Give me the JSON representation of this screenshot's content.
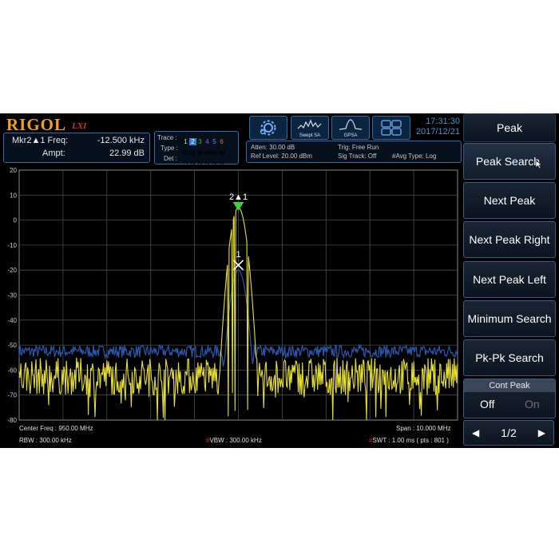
{
  "brand": {
    "logo": "RIGOL",
    "sub": "LXI"
  },
  "marker": {
    "freq_label": "Mkr2▲1 Freq:",
    "freq_value": "-12.500 kHz",
    "ampt_label": "Ampt:",
    "ampt_value": "22.99 dB"
  },
  "trace": {
    "label": "Trace :",
    "type_label": "Type :",
    "det_label": "Det :",
    "numbers": [
      "1",
      "2",
      "3",
      "4",
      "5",
      "6"
    ],
    "number_colors": [
      "#e8e070",
      "#ffffff",
      "#30c030",
      "#d040d0",
      "#40a0f0",
      "#f07030"
    ],
    "types": [
      "W",
      "M",
      "W",
      "W",
      "W",
      "W"
    ],
    "dets": [
      "S",
      "N",
      "N",
      "N",
      "N",
      "N"
    ]
  },
  "settings": {
    "atten": "Atten: 30.00 dB",
    "ref_level": "Ref Level: 20.00 dBm",
    "trig": "Trig: Free Run",
    "sig_track": "Sig Track: Off",
    "avg_type": "#Avg Type: Log"
  },
  "mode_icons": [
    {
      "name": "setup-icon",
      "label": ""
    },
    {
      "name": "swept-sa-icon",
      "label": "Swept SA"
    },
    {
      "name": "gpsa-icon",
      "label": "GPSA"
    },
    {
      "name": "layout-grid-icon",
      "label": ""
    }
  ],
  "clock": {
    "time": "17:31:30",
    "date": "2017/12/21"
  },
  "softkeys": {
    "title": "Peak",
    "items": [
      "Peak Search",
      "Next Peak",
      "Next Peak Right",
      "Next Peak Left",
      "Minimum Search",
      "Pk-Pk Search"
    ],
    "cont_peak": {
      "label": "Cont Peak",
      "off": "Off",
      "on": "On"
    },
    "page": "1/2"
  },
  "chart_data": {
    "type": "line",
    "y_ticks": [
      "20",
      "10",
      "0",
      "-10",
      "-20",
      "-30",
      "-40",
      "-50",
      "-60",
      "-70",
      "-80"
    ],
    "ylim": [
      -80,
      20
    ],
    "grid": true,
    "series": [
      {
        "color": "#e8e030",
        "peak_db": 5,
        "noise_floor_db": [
          -70,
          -55
        ]
      },
      {
        "color": "#2858b0",
        "peak_db": -20,
        "noise_floor_db": [
          -55,
          -50
        ]
      }
    ],
    "markers": [
      {
        "label": "2▲1",
        "value_db": 5
      },
      {
        "label": "1",
        "value_db": -18
      }
    ]
  },
  "footer": {
    "center_freq": "Center Freq : 950.00 MHz",
    "span": "Span : 10.000 MHz",
    "rbw": "RBW : 300.00 kHz",
    "vbw": "VBW : 300.00 kHz",
    "swt": "SWT : 1.00 ms ( pts : 801 )",
    "hash": "#"
  }
}
